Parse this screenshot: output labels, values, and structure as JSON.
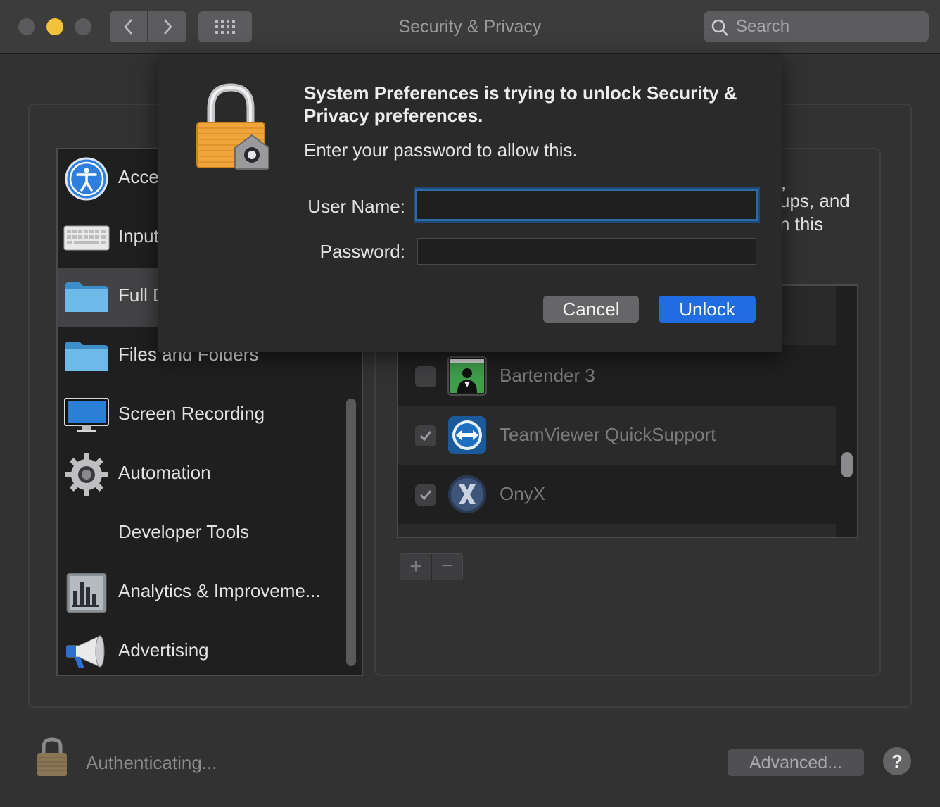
{
  "window": {
    "title": "Security & Privacy",
    "search_placeholder": "Search"
  },
  "sidebar": {
    "items": [
      {
        "label": "Acce",
        "icon": "accessibility-icon"
      },
      {
        "label": "Input",
        "icon": "keyboard-icon"
      },
      {
        "label": "Full D",
        "icon": "folder-icon"
      },
      {
        "label": "Files and Folders",
        "icon": "folder-icon"
      },
      {
        "label": "Screen Recording",
        "icon": "display-icon"
      },
      {
        "label": "Automation",
        "icon": "gear-icon"
      },
      {
        "label": "Developer Tools",
        "icon": ""
      },
      {
        "label": "Analytics & Improveme...",
        "icon": "analytics-icon"
      },
      {
        "label": "Advertising",
        "icon": "megaphone-icon"
      }
    ]
  },
  "description_fragments": [
    ",",
    "ups, and",
    "n this"
  ],
  "apps": [
    {
      "name": "Bartender 3",
      "checked": false,
      "icon": "bartender-icon"
    },
    {
      "name": "TeamViewer QuickSupport",
      "checked": true,
      "icon": "teamviewer-icon"
    },
    {
      "name": "OnyX",
      "checked": true,
      "icon": "onyx-icon"
    }
  ],
  "list_controls": {
    "add": "+",
    "remove": "−"
  },
  "dialog": {
    "title": "System Preferences is trying to unlock Security & Privacy preferences.",
    "subtitle": "Enter your password to allow this.",
    "username_label": "User Name:",
    "password_label": "Password:",
    "username_value": "",
    "password_value": "",
    "cancel_label": "Cancel",
    "unlock_label": "Unlock"
  },
  "footer": {
    "status": "Authenticating...",
    "advanced_label": "Advanced...",
    "help_label": "?"
  },
  "colors": {
    "accent": "#1f6de0",
    "focus_ring": "#2a6aa8",
    "traffic_min": "#f2c33a"
  }
}
